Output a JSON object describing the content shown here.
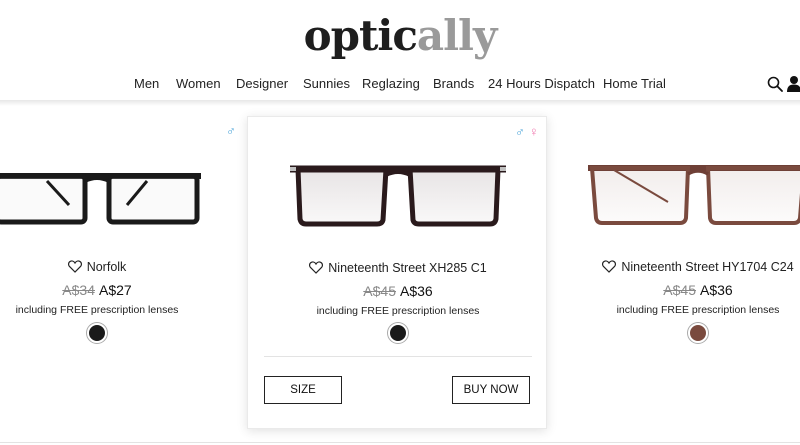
{
  "brand": {
    "logo_part1": "optic",
    "logo_part2": "ally"
  },
  "nav": [
    {
      "label": "Men"
    },
    {
      "label": "Women"
    },
    {
      "label": "Designer"
    },
    {
      "label": "Sunnies"
    },
    {
      "label": "Reglazing"
    },
    {
      "label": "Brands"
    },
    {
      "label": "24 Hours Dispatch"
    },
    {
      "label": "Home Trial"
    }
  ],
  "icons": {
    "search": "search-icon",
    "user": "user-icon",
    "wishlist": "heart-icon",
    "male": "male-symbol-icon",
    "female": "female-symbol-icon"
  },
  "symbols": {
    "male": "♂",
    "female": "♀"
  },
  "colors": {
    "male": "#4aa3d8",
    "female": "#f07ab0",
    "frame_black": "#1a1a1a",
    "frame_brown": "#7a4a3e"
  },
  "products": [
    {
      "name": "Norfolk",
      "old_price": "A$34",
      "new_price": "A$27",
      "included": "including FREE prescription lenses",
      "swatch_color": "#1a1a1a"
    },
    {
      "name": "Nineteenth Street XH285 C1",
      "old_price": "A$45",
      "new_price": "A$36",
      "included": "including FREE prescription lenses",
      "swatch_color": "#1a1a1a"
    },
    {
      "name": "Nineteenth Street HY1704 C24",
      "old_price": "A$45",
      "new_price": "A$36",
      "included": "including FREE prescription lenses",
      "swatch_color": "#7a4a3e"
    }
  ],
  "actions": {
    "size_label": "SIZE",
    "buy_label": "BUY NOW"
  }
}
